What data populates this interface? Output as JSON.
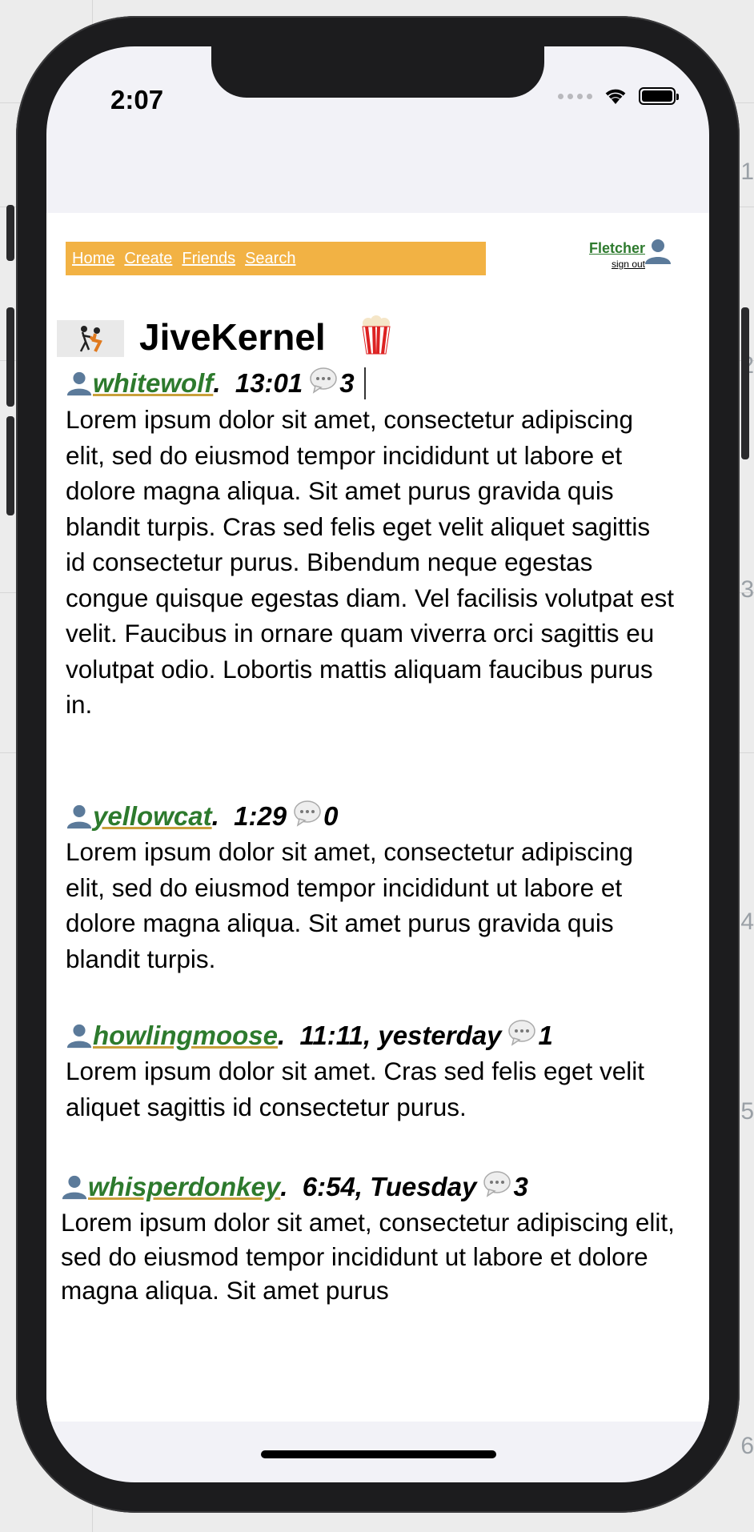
{
  "status_bar": {
    "time": "2:07"
  },
  "nav": {
    "links": [
      "Home",
      "Create",
      "Friends",
      "Search"
    ]
  },
  "user": {
    "name": "Fletcher",
    "sign_out": "sign out"
  },
  "site": {
    "title": "JiveKernel"
  },
  "posts": [
    {
      "username": "whitewolf",
      "time": "13:01",
      "comments": "3",
      "body": "Lorem ipsum dolor sit amet, consectetur adipiscing elit, sed do eiusmod tempor incididunt ut labore et dolore magna aliqua. Sit amet purus gravida quis blandit turpis. Cras sed felis eget velit aliquet sagittis id consectetur purus. Bibendum neque egestas congue quisque egestas diam. Vel facilisis volutpat est velit. Faucibus in ornare quam viverra orci sagittis eu volutpat odio. Lobortis mattis aliquam faucibus purus in."
    },
    {
      "username": "yellowcat",
      "time": "1:29",
      "comments": "0",
      "body": "Lorem ipsum dolor sit amet, consectetur adipiscing elit, sed do eiusmod tempor incididunt ut labore et dolore magna aliqua. Sit amet purus gravida quis blandit turpis."
    },
    {
      "username": "howlingmoose",
      "time": "11:11, yesterday",
      "comments": "1",
      "body": "Lorem ipsum dolor sit amet. Cras sed felis eget velit aliquet sagittis id consectetur purus."
    },
    {
      "username": "whisperdonkey",
      "time": "6:54, Tuesday",
      "comments": "3",
      "body": "Lorem ipsum dolor sit amet, consectetur adipiscing elit, sed do eiusmod tempor incididunt ut labore et dolore magna aliqua. Sit amet purus"
    }
  ],
  "background_numbers": [
    "1",
    "2",
    "3",
    "4",
    "5",
    "6"
  ],
  "colors": {
    "nav_bg": "#f2b244",
    "username": "#2d7a2d"
  }
}
